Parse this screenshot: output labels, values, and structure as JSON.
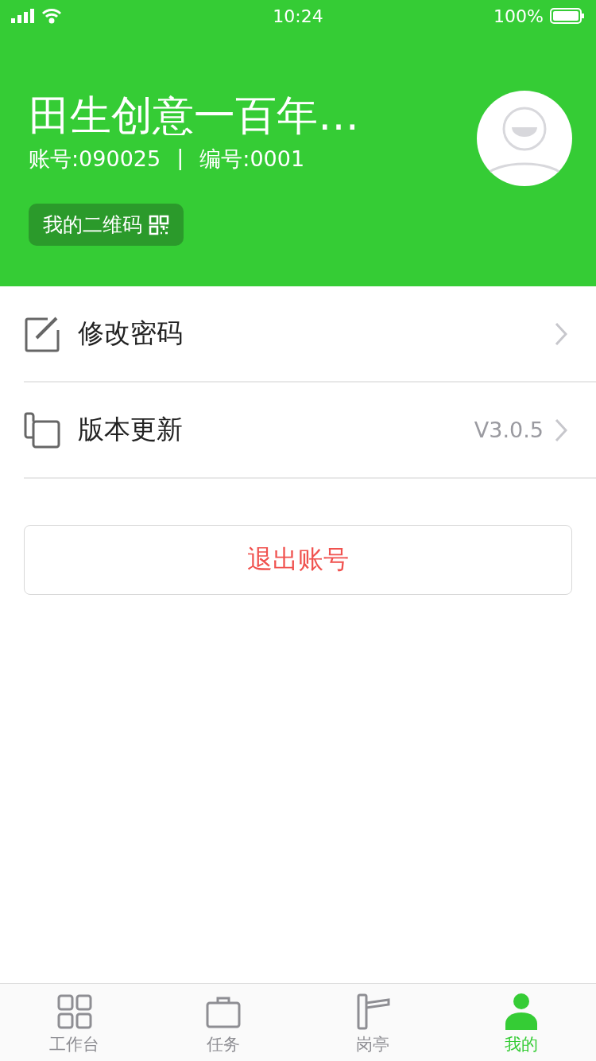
{
  "status_bar": {
    "time": "10:24",
    "battery": "100%"
  },
  "profile": {
    "name": "田生创意一百年…",
    "account": "账号:090025",
    "separator": "|",
    "number": "编号:0001",
    "qr_button": "我的二维码"
  },
  "menu": [
    {
      "kind": "edit",
      "label": "修改密码"
    },
    {
      "kind": "version",
      "label": "版本更新",
      "value": "V3.0.5"
    }
  ],
  "logout": "退出账号",
  "tabs": [
    {
      "kind": "grid",
      "label": "工作台",
      "selected": false
    },
    {
      "kind": "case",
      "label": "任务",
      "selected": false
    },
    {
      "kind": "gate",
      "label": "岗亭",
      "selected": false
    },
    {
      "kind": "person",
      "label": "我的",
      "selected": true
    }
  ]
}
